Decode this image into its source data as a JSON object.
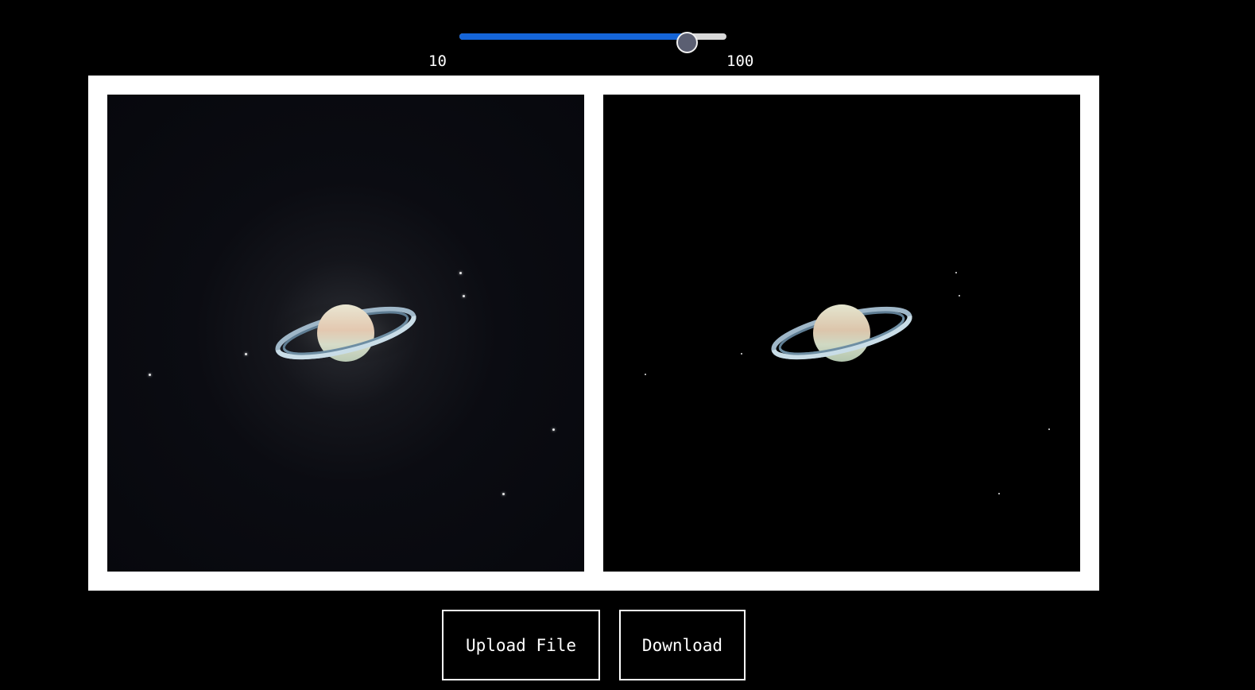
{
  "slider": {
    "min_label": "10",
    "max_label": "100",
    "min": 10,
    "max": 100,
    "value": 87,
    "colors": {
      "fill": "#1565d8",
      "track": "#d9d9d9",
      "thumb": "#5b5f72"
    }
  },
  "panels": {
    "original": {
      "icon": "saturn-image-original"
    },
    "processed": {
      "icon": "saturn-image-processed"
    }
  },
  "buttons": {
    "upload_label": "Upload File",
    "download_label": "Download"
  },
  "colors": {
    "background": "#000000",
    "frame": "#ffffff"
  }
}
